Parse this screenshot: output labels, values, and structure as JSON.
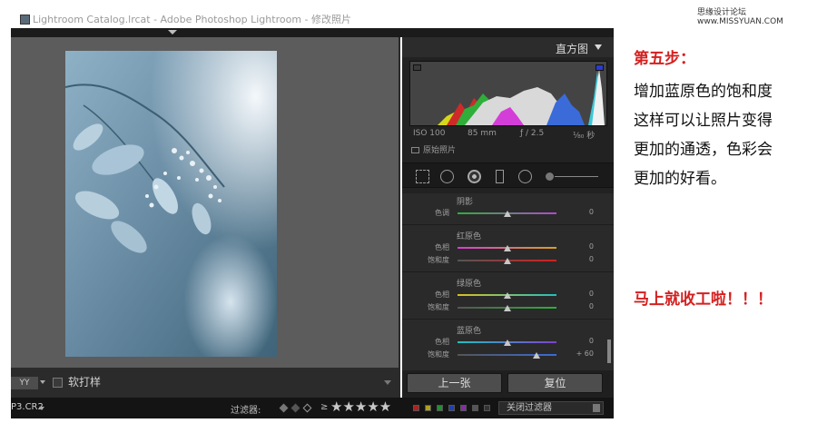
{
  "window": {
    "title": "Lightroom Catalog.lrcat - Adobe Photoshop Lightroom - 修改照片"
  },
  "watermark": {
    "text": "思缘设计论坛 www.MISSYUAN.COM"
  },
  "histogram": {
    "title": "直方图",
    "iso": "ISO 100",
    "focal": "85 mm",
    "aperture": "ƒ / 2.5",
    "shutter": "¹⁄₈₀ 秒",
    "original_label": "原始照片"
  },
  "hsl": {
    "sections": [
      {
        "title": "阴影",
        "sliders": [
          {
            "label": "色调",
            "value": "0",
            "level": 0.5
          }
        ]
      },
      {
        "title": "红原色",
        "sliders": [
          {
            "label": "色相",
            "value": "0",
            "level": 0.5
          },
          {
            "label": "饱和度",
            "value": "0",
            "level": 0.5
          }
        ]
      },
      {
        "title": "绿原色",
        "sliders": [
          {
            "label": "色相",
            "value": "0",
            "level": 0.5
          },
          {
            "label": "饱和度",
            "value": "0",
            "level": 0.5
          }
        ]
      },
      {
        "title": "蓝原色",
        "sliders": [
          {
            "label": "色相",
            "value": "0",
            "level": 0.5
          },
          {
            "label": "饱和度",
            "value": "+ 60",
            "level": 0.8
          }
        ]
      }
    ]
  },
  "buttons": {
    "previous": "上一张",
    "reset": "复位"
  },
  "toolbar": {
    "view_mode": "YY",
    "soft_proof": "软打样"
  },
  "filmstrip": {
    "filename": "P3.CR2",
    "filter_label": "过滤器:",
    "rating_op": "≥",
    "stars": "★★★★★",
    "filter_preset": "关闭过滤器"
  },
  "annotation": {
    "step": "第五步：",
    "lines": [
      "增加蓝原色的饱和度",
      "这样可以让照片变得",
      "更加的通透，色彩会",
      "更加的好看。"
    ],
    "done": "马上就收工啦！！！"
  },
  "colors": {
    "accent_red": "#d42020",
    "panel_bg": "#222222",
    "viewer_bg": "#5c5c5c",
    "clip_blue": "#2b3bd0"
  }
}
